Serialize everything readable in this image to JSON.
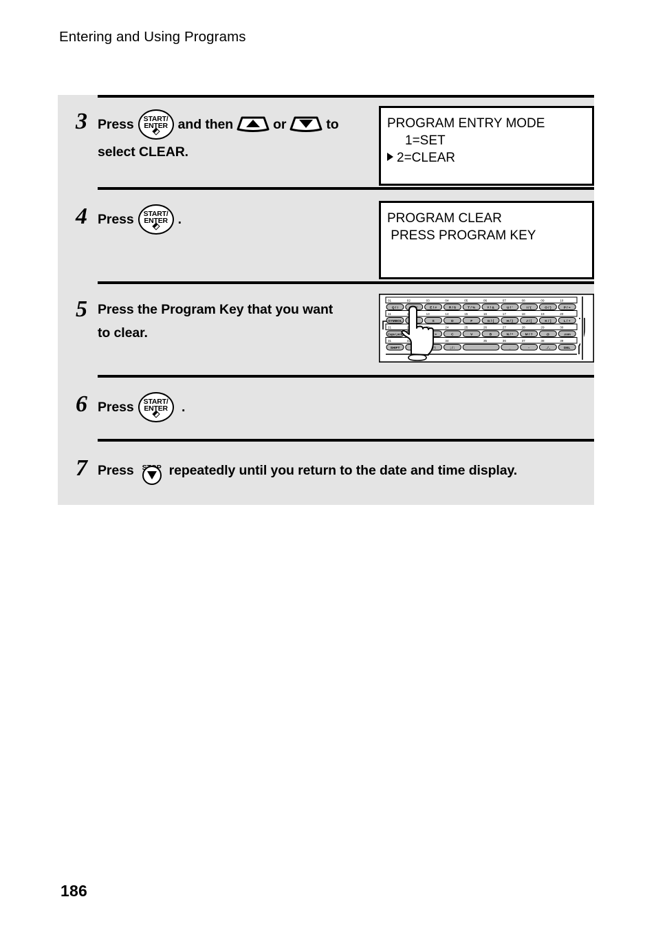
{
  "header": {
    "title": "Entering and Using Programs"
  },
  "page": {
    "number": "186",
    "background": "#ffffff",
    "panel_background": "#e4e4e4",
    "rule_color": "#000000"
  },
  "steps": [
    {
      "number": "3",
      "text_before": "Press",
      "key1": {
        "icon": "start-enter-key",
        "line1": "START/",
        "line2": "ENTER"
      },
      "text_mid": "and then",
      "key2": {
        "icon": "up-arrow-key"
      },
      "text_or": "or",
      "key3": {
        "icon": "down-arrow-key"
      },
      "text_after": "to",
      "line2": "select CLEAR.",
      "display": {
        "kind": "lcd",
        "lines": [
          {
            "text": "PROGRAM ENTRY MODE",
            "caret": false,
            "indent": 0
          },
          {
            "text": "1=SET",
            "caret": false,
            "indent": 2
          },
          {
            "text": "2=CLEAR",
            "caret": true,
            "indent": 0
          }
        ]
      }
    },
    {
      "number": "4",
      "text_before": "Press",
      "key1": {
        "icon": "start-enter-key",
        "line1": "START/",
        "line2": "ENTER"
      },
      "text_after": ".",
      "display": {
        "kind": "lcd",
        "lines": [
          {
            "text": "PROGRAM CLEAR",
            "caret": false,
            "indent": 0
          },
          {
            "text": " PRESS PROGRAM KEY",
            "caret": false,
            "indent": 0
          }
        ]
      }
    },
    {
      "number": "5",
      "line1": "Press the Program Key that you want",
      "line2": "to clear.",
      "display": {
        "kind": "keyboard"
      }
    },
    {
      "number": "6",
      "text_before": "Press",
      "key1": {
        "icon": "start-enter-key",
        "line1": "START/",
        "line2": "ENTER"
      },
      "text_after": "."
    },
    {
      "number": "7",
      "text_before": "Press",
      "key1": {
        "icon": "stop-key",
        "caption": "STOP"
      },
      "text_after": "repeatedly until you return to the date and time display."
    }
  ],
  "keyboard": {
    "label": "program-keys-keyboard-illustration",
    "rows": [
      {
        "numbers": [
          "01",
          "02",
          "03",
          "04",
          "05",
          "06",
          "07",
          "08",
          "09",
          "10"
        ],
        "keys": [
          "Q / !",
          "W / \"",
          "E / #",
          "R / $",
          "T / %",
          "Y / &",
          "U / '",
          "I / (",
          "O / )",
          "P / ="
        ]
      },
      {
        "numbers": [
          "11",
          "12",
          "13",
          "14",
          "15",
          "16",
          "17",
          "18",
          "19",
          "20"
        ],
        "keys": [
          "SYMBOL",
          "A / |",
          "S",
          "D",
          "F",
          "G / {",
          "H / }",
          "J / [",
          "K / ]",
          "L / +"
        ]
      },
      {
        "numbers": [
          "21",
          "22",
          "23",
          "24",
          "25",
          "26",
          "27",
          "28",
          "29",
          "30"
        ],
        "keys": [
          "Caps Lock",
          "Z / <",
          "X / >",
          "C",
          "V",
          "B",
          "N / *",
          "M / ?",
          "@",
          ".com"
        ]
      },
      {
        "numbers": [
          "31",
          "32",
          "33",
          "34",
          "35",
          "36",
          "37",
          "38",
          "39"
        ],
        "keys": [
          "SHIFT",
          "~ / ^",
          "/ / \\",
          "; / :",
          "",
          "_",
          "-",
          ". / ,",
          "DEL"
        ]
      }
    ],
    "hand": "pointing-hand-pressing-key"
  }
}
